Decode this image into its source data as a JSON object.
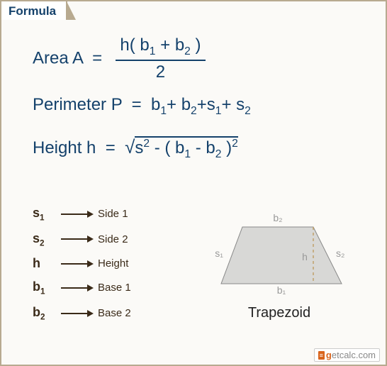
{
  "tab_label": "Formula",
  "formulas": {
    "area": {
      "label": "Area A",
      "numerator_prefix": "h( b",
      "numerator_sub1": "1",
      "numerator_plus": " +  b",
      "numerator_sub2": "2",
      "numerator_suffix": " )",
      "denominator": "2"
    },
    "perimeter": {
      "label": "Perimeter P",
      "rhs_parts": [
        "b",
        "1",
        "+ b",
        "2",
        "+s",
        "1",
        "+ s",
        "2"
      ]
    },
    "height": {
      "label": "Height h",
      "rhs": " s² - ( b₁ -  b₂ )²"
    }
  },
  "legend": [
    {
      "sym": "s",
      "sub": "1",
      "text": "Side 1"
    },
    {
      "sym": "s",
      "sub": "2",
      "text": "Side 2"
    },
    {
      "sym": "h",
      "sub": "",
      "text": "Height"
    },
    {
      "sym": "b",
      "sub": "1",
      "text": "Base 1"
    },
    {
      "sym": "b",
      "sub": "2",
      "text": "Base 2"
    }
  ],
  "figure": {
    "caption": "Trapezoid",
    "labels": {
      "b1": "b₁",
      "b2": "b₂",
      "s1": "s₁",
      "s2": "s₂",
      "h": "h"
    }
  },
  "brand": {
    "icon": "≡",
    "pre": "g",
    "rest": "etcalc",
    "tld": ".com"
  }
}
